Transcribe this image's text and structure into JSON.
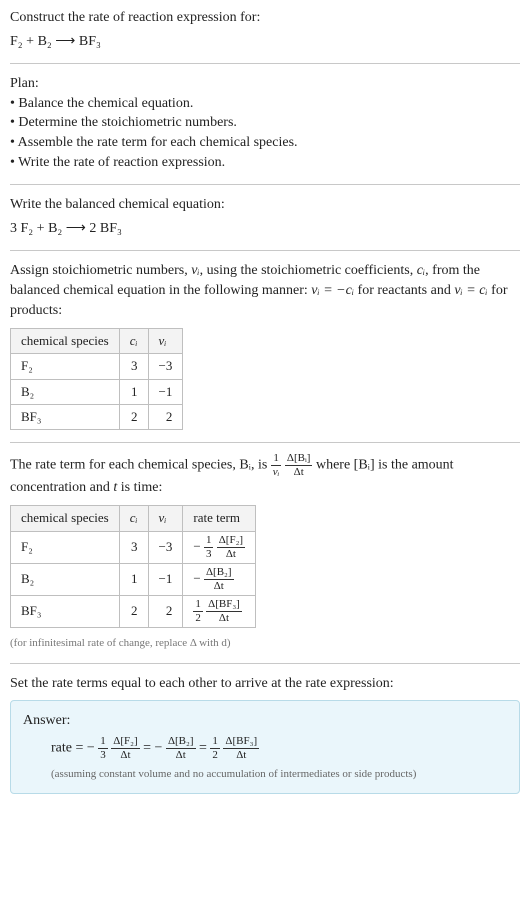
{
  "title": "Construct the rate of reaction expression for:",
  "reaction_unbalanced": "F₂ + B₂ ⟶ BF₃",
  "plan_label": "Plan:",
  "plan_items": [
    "Balance the chemical equation.",
    "Determine the stoichiometric numbers.",
    "Assemble the rate term for each chemical species.",
    "Write the rate of reaction expression."
  ],
  "balanced_label": "Write the balanced chemical equation:",
  "reaction_balanced": "3 F₂ + B₂ ⟶ 2 BF₃",
  "assign_text_a": "Assign stoichiometric numbers, ",
  "assign_text_b": ", using the stoichiometric coefficients, ",
  "assign_text_c": ", from the balanced chemical equation in the following manner: ",
  "assign_text_d": " for reactants and ",
  "assign_text_e": " for products:",
  "nu_i": "νᵢ",
  "c_i": "cᵢ",
  "eq_react": "νᵢ = −cᵢ",
  "eq_prod": "νᵢ = cᵢ",
  "table1": {
    "headers": [
      "chemical species",
      "cᵢ",
      "νᵢ"
    ],
    "rows": [
      [
        "F₂",
        "3",
        "−3"
      ],
      [
        "B₂",
        "1",
        "−1"
      ],
      [
        "BF₃",
        "2",
        "2"
      ]
    ]
  },
  "rate_term_a": "The rate term for each chemical species, Bᵢ, is ",
  "rate_term_b": " where [Bᵢ] is the amount concentration and ",
  "rate_term_c": " is time:",
  "t_var": "t",
  "generic_frac_1n": "1",
  "generic_frac_1d": "νᵢ",
  "generic_frac_2n": "Δ[Bᵢ]",
  "generic_frac_2d": "Δt",
  "table2": {
    "headers": [
      "chemical species",
      "cᵢ",
      "νᵢ",
      "rate term"
    ],
    "rows": [
      {
        "sp": "F₂",
        "c": "3",
        "nu": "−3",
        "pre": "− ",
        "fn": "1",
        "fd": "3",
        "gn": "Δ[F₂]",
        "gd": "Δt"
      },
      {
        "sp": "B₂",
        "c": "1",
        "nu": "−1",
        "pre": "− ",
        "fn": "",
        "fd": "",
        "gn": "Δ[B₂]",
        "gd": "Δt"
      },
      {
        "sp": "BF₃",
        "c": "2",
        "nu": "2",
        "pre": "",
        "fn": "1",
        "fd": "2",
        "gn": "Δ[BF₃]",
        "gd": "Δt"
      }
    ]
  },
  "infinitesimal_note": "(for infinitesimal rate of change, replace Δ with d)",
  "set_equal": "Set the rate terms equal to each other to arrive at the rate expression:",
  "answer_label": "Answer:",
  "rate_eq_prefix": "rate = − ",
  "eqsep": " = − ",
  "eqsep2": " = ",
  "assumption": "(assuming constant volume and no accumulation of intermediates or side products)",
  "chart_data": {
    "type": "table",
    "title": "Stoichiometric numbers and rate terms",
    "tables": [
      {
        "columns": [
          "chemical species",
          "c_i",
          "nu_i"
        ],
        "rows": [
          [
            "F2",
            3,
            -3
          ],
          [
            "B2",
            1,
            -1
          ],
          [
            "BF3",
            2,
            2
          ]
        ]
      },
      {
        "columns": [
          "chemical species",
          "c_i",
          "nu_i",
          "rate term"
        ],
        "rows": [
          [
            "F2",
            3,
            -3,
            "-(1/3) d[F2]/dt"
          ],
          [
            "B2",
            1,
            -1,
            "- d[B2]/dt"
          ],
          [
            "BF3",
            2,
            2,
            "(1/2) d[BF3]/dt"
          ]
        ]
      }
    ],
    "rate_expression": "rate = -(1/3) d[F2]/dt = - d[B2]/dt = (1/2) d[BF3]/dt"
  }
}
